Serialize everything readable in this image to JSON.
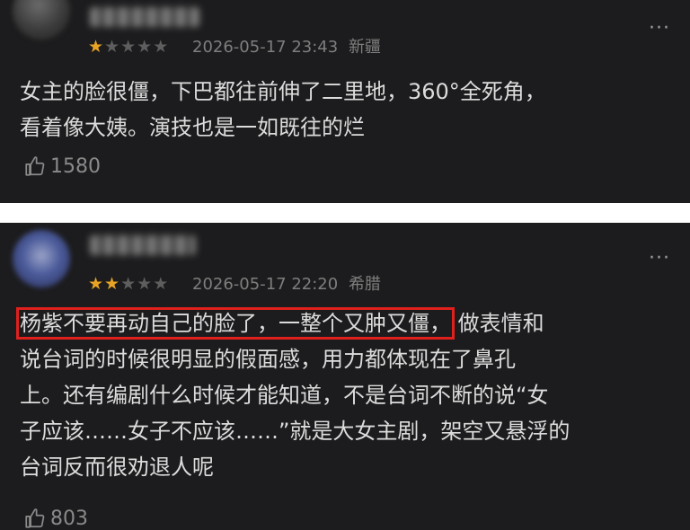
{
  "comments": [
    {
      "rating": 1,
      "date": "2026-05-17 23:43",
      "location": "新疆",
      "text_lines": [
        "女主的脸很僵，下巴都往前伸了二里地，360°全死角，",
        "看着像大姨。演技也是一如既往的烂"
      ],
      "likes": "1580"
    },
    {
      "rating": 2,
      "date": "2026-05-17 22:20",
      "location": "希腊",
      "highlight_text": "杨紫不要再动自己的脸了，一整个又肿又僵，",
      "text_lines": [
        "做表情和",
        "说台词的时候很明显的假面感，用力都体现在了鼻孔",
        "上。还有编剧什么时候才能知道，不是台词不断的说“女",
        "子应该……女子不应该……”就是大女主剧，架空又悬浮的",
        "台词反而很劝退人呢"
      ],
      "likes": "803"
    }
  ],
  "more_glyph": "···",
  "colors": {
    "card_bg": "#1c1c1e",
    "star_filled": "#e8a325",
    "star_empty": "#5e5e5e",
    "highlight_box": "#e0201d"
  }
}
